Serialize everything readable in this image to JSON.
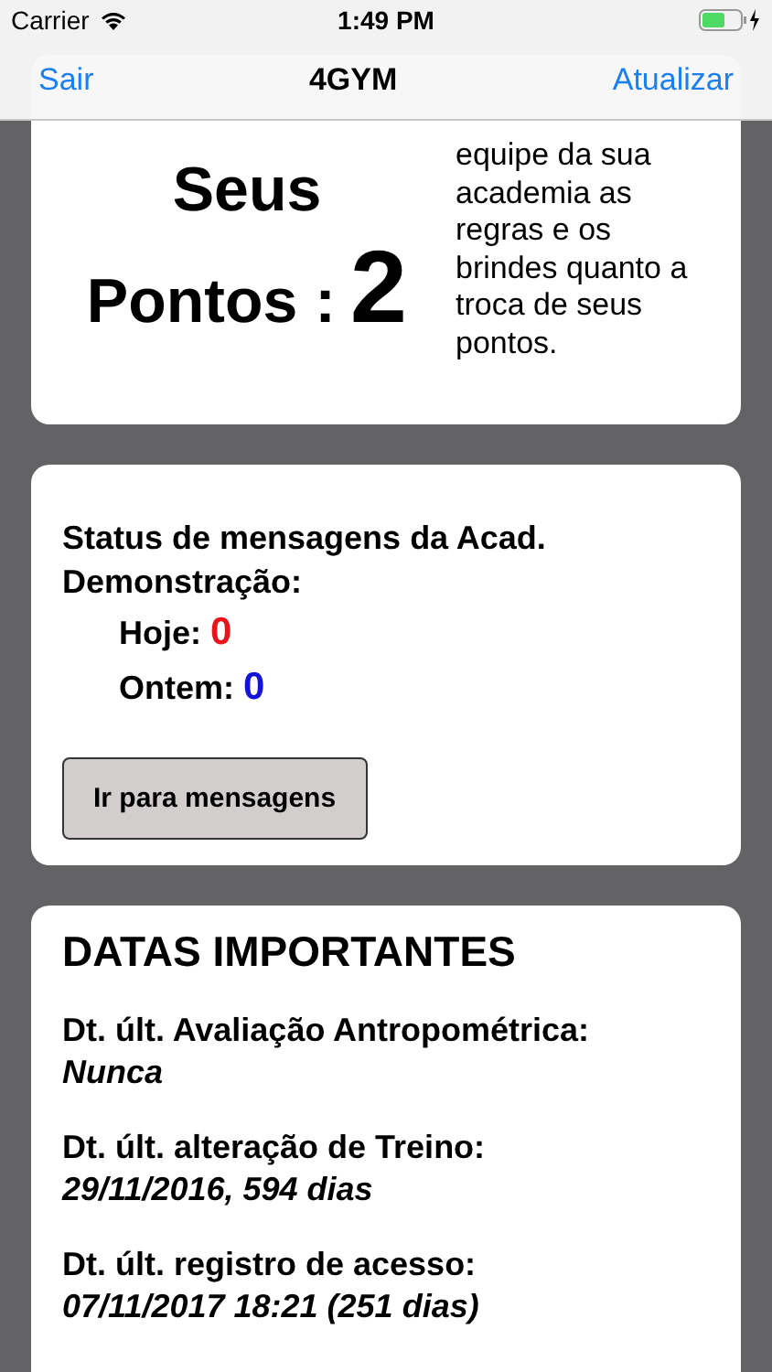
{
  "status_bar": {
    "carrier": "Carrier",
    "time": "1:49 PM"
  },
  "nav_bar": {
    "left_button": "Sair",
    "title": "4GYM",
    "right_button": "Atualizar"
  },
  "points_card": {
    "label_line_1": "Seus",
    "label_line_2": "Pontos :",
    "points": "2",
    "note": "equipe da sua academia as regras e os brindes quanto a troca de seus pontos."
  },
  "messages_card": {
    "title": "Status de mensagens da Acad. Demonstração:",
    "counts": [
      {
        "label": "Hoje:",
        "value": "0",
        "color": "#e8141b"
      },
      {
        "label": "Ontem:",
        "value": "0",
        "color": "#1414d8"
      }
    ],
    "button": "Ir para mensagens"
  },
  "dates_card": {
    "title": "DATAS IMPORTANTES",
    "items": [
      {
        "label": "Dt. últ. Avaliação Antropométrica:",
        "value": "Nunca"
      },
      {
        "label": "Dt. últ. alteração de Treino:",
        "value": "29/11/2016, 594 dias"
      },
      {
        "label": "Dt. últ. registro de acesso:",
        "value": "07/11/2017 18:21 (251 dias)"
      }
    ]
  }
}
